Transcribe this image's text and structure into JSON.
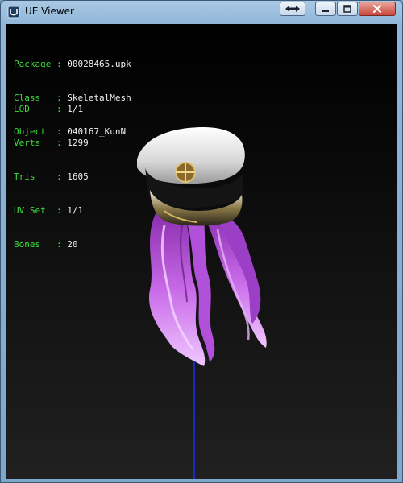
{
  "window": {
    "title": "UE Viewer"
  },
  "info": {
    "header_rows": [
      {
        "key": "Package",
        "sep": ":",
        "value": "00028465.upk"
      },
      {
        "key": "Class  ",
        "sep": ":",
        "value": "SkeletalMesh"
      },
      {
        "key": "Object ",
        "sep": ":",
        "value": "040167_KunN"
      }
    ],
    "stats_rows": [
      {
        "key": "LOD    ",
        "sep": ":",
        "value": "1/1"
      },
      {
        "key": "Verts  ",
        "sep": ":",
        "value": "1299"
      },
      {
        "key": "Tris   ",
        "sep": ":",
        "value": "1605"
      },
      {
        "key": "UV Set ",
        "sep": ":",
        "value": "1/1"
      },
      {
        "key": "Bones  ",
        "sep": ":",
        "value": "20"
      }
    ]
  },
  "colors": {
    "label": "#3cdc3c",
    "value": "#f0f0f0",
    "hair": "#c060e0",
    "bone_axis": "#1a2cff"
  },
  "icons": {
    "app": "ue-viewer-app-icon",
    "restore": "restore-arrows-icon",
    "minimize": "minimize-icon",
    "maximize": "maximize-icon",
    "close": "close-icon"
  }
}
